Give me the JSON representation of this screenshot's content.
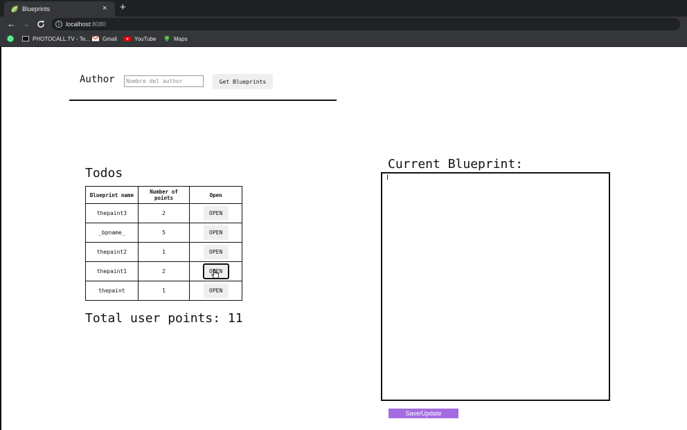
{
  "browser": {
    "tab_title": "Blueprints",
    "tab_close": "×",
    "new_tab": "+",
    "url_host": "localhost",
    "url_port": ":8080",
    "bookmarks": [
      "PHOTOCALL.TV - Te...",
      "Gmail",
      "YouTube",
      "Maps"
    ]
  },
  "author": {
    "label": "Author",
    "placeholder": "Nombre del author",
    "button": "Get Blueprints"
  },
  "blueprints": {
    "title": "Todos",
    "headers": [
      "Blueprint name",
      "Number of points",
      "Open"
    ],
    "rows": [
      {
        "name": "thepaint3",
        "points": "2",
        "action": "OPEN"
      },
      {
        "name": "_bpname_",
        "points": "5",
        "action": "OPEN"
      },
      {
        "name": "thepaint2",
        "points": "1",
        "action": "OPEN"
      },
      {
        "name": "thepaint1",
        "points": "2",
        "action": "OPEN"
      },
      {
        "name": "thepaint",
        "points": "1",
        "action": "OPEN"
      }
    ],
    "total": "Total user points: 11"
  },
  "current": {
    "title": "Current Blueprint:",
    "save_button": "Save/Update",
    "save_color": "#a46ce0"
  }
}
